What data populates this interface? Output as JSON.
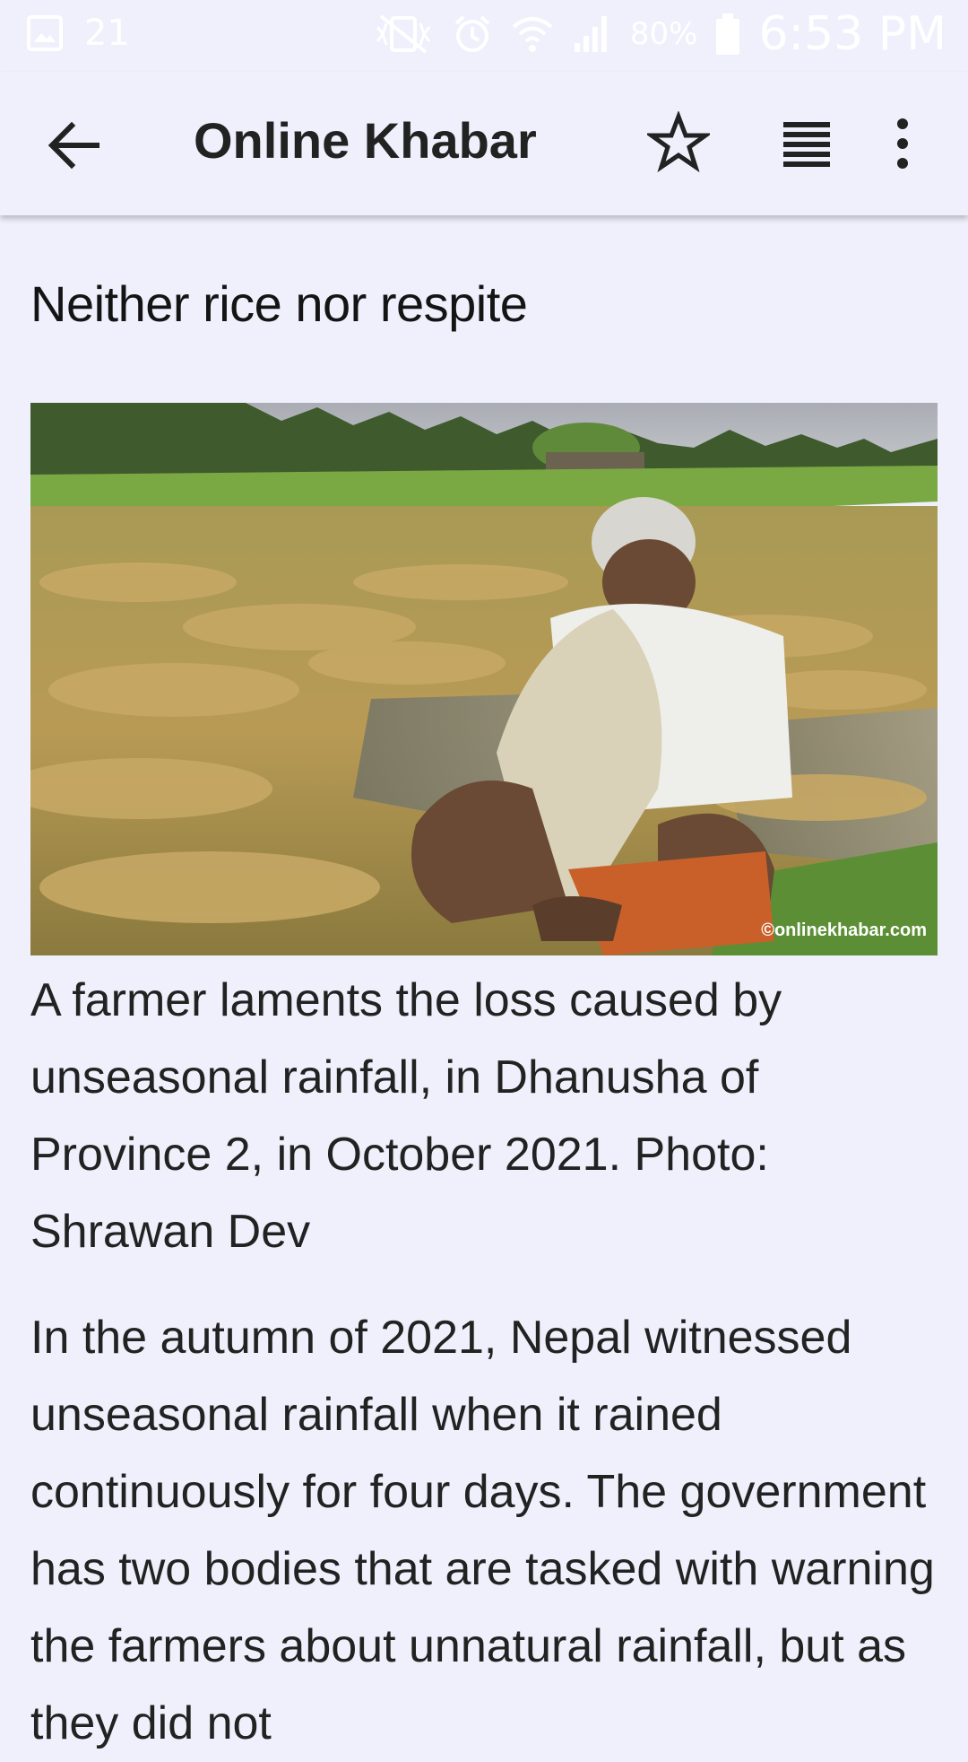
{
  "status_bar": {
    "notification_count": "21",
    "battery_percent": "80%",
    "time": "6:53 PM",
    "icons": [
      "gallery-notification-icon",
      "mute-vibrate-icon",
      "alarm-icon",
      "wifi-icon",
      "signal-icon",
      "battery-icon"
    ]
  },
  "app_bar": {
    "title": "Online Khabar",
    "icons": [
      "back-arrow-icon",
      "star-outline-icon",
      "list-view-icon",
      "more-vert-icon"
    ]
  },
  "article": {
    "headline": "Neither rice nor respite",
    "photo_watermark": "©onlinekhabar.com",
    "caption": "A farmer laments the loss caused by unseasonal rainfall, in Dhanusha of Province 2, in October 2021. Photo: Shrawan Dev",
    "body": "In the autumn of 2021, Nepal witnessed unseasonal rainfall when it rained continuously for four days. The government has two bodies that are tasked with warning the farmers about unnatural rainfall, but as they did not"
  },
  "colors": {
    "background": "#eff0fb",
    "text_primary": "#222222",
    "headline": "#141414"
  }
}
